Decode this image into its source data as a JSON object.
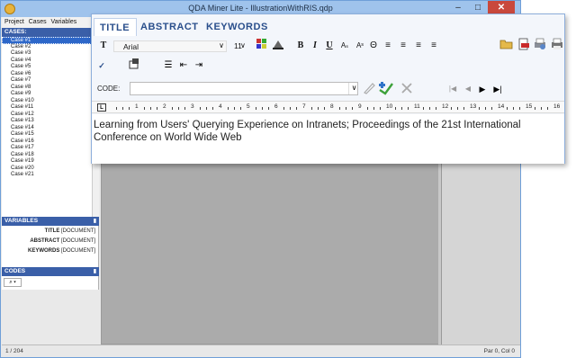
{
  "window": {
    "title": "QDA Miner Lite - IllustrationWithRIS.qdp",
    "min_glyph": "–",
    "max_glyph": "□",
    "close_glyph": "✕"
  },
  "menu": [
    "Project",
    "Cases",
    "Variables"
  ],
  "cases_panel": {
    "header": "CASES:",
    "items": [
      "Case #1",
      "Case #2",
      "Case #3",
      "Case #4",
      "Case #5",
      "Case #6",
      "Case #7",
      "Case #8",
      "Case #9",
      "Case #10",
      "Case #11",
      "Case #12",
      "Case #13",
      "Case #14",
      "Case #15",
      "Case #16",
      "Case #17",
      "Case #18",
      "Case #19",
      "Case #20",
      "Case #21"
    ],
    "selected_index": 0
  },
  "variables_panel": {
    "header": "VARIABLES",
    "items": [
      {
        "name": "TITLE",
        "type": "[DOCUMENT]"
      },
      {
        "name": "ABSTRACT",
        "type": "[DOCUMENT]"
      },
      {
        "name": "KEYWORDS",
        "type": "[DOCUMENT]"
      }
    ]
  },
  "codes_panel": {
    "header": "CODES",
    "search_glyph": "⌕ ▾"
  },
  "editor": {
    "tabs": [
      "TITLE",
      "ABSTRACT",
      "KEYWORDS"
    ],
    "active_tab": "TITLE",
    "font": "Arial",
    "font_size": "11",
    "code_label": "CODE:",
    "code_value": "",
    "text": "Learning from Users' Querying Experience on Intranets; Proceedings of the 21st International Conference on World Wide Web"
  },
  "toolbar": {
    "font_icon_glyph": "T",
    "bold_glyph": "B",
    "italic_glyph": "I",
    "underline_glyph": "U",
    "subscript_glyph": "Aₛ",
    "superscript_glyph": "Aˢ",
    "strike_glyph": "Θ",
    "align_left_glyph": "≡",
    "align_center_glyph": "≡",
    "align_right_glyph": "≡",
    "justify_glyph": "≡",
    "spell_glyph": "✓",
    "bullets_glyph": "☰",
    "indent_glyph": "⇤",
    "outdent_glyph": "⇥",
    "nav_first_glyph": "|◀",
    "nav_prev_glyph": "◀",
    "nav_next_glyph": "▶",
    "nav_last_glyph": "▶|"
  },
  "ruler": {
    "tab_glyph": "L",
    "numbers": [
      "1",
      "2",
      "3",
      "4",
      "5",
      "6",
      "7",
      "8",
      "9",
      "10",
      "11",
      "12",
      "13",
      "14",
      "15",
      "16"
    ]
  },
  "status": {
    "left": "1 / 204",
    "right": "Par 0, Col 0"
  },
  "colors": {
    "accent": "#2d67c9",
    "panel_header": "#3a5fa8",
    "tab_text": "#2a4f8c",
    "close": "#c9483c"
  }
}
